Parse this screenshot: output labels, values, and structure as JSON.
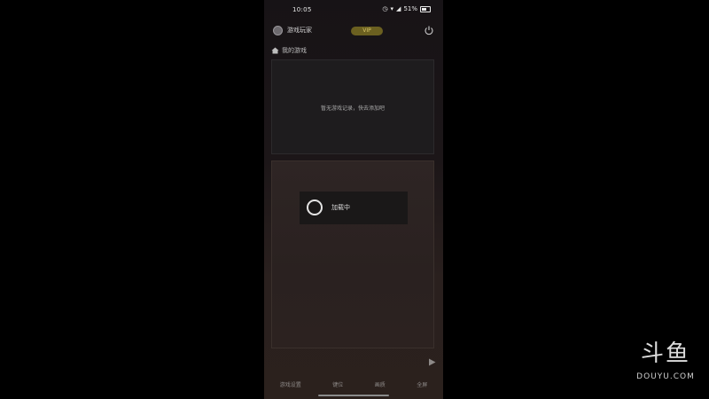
{
  "status_bar": {
    "time": "10:05",
    "icons": [
      "clock-icon",
      "wifi-icon",
      "signal-icon",
      "battery-icon"
    ],
    "battery": "51%"
  },
  "header": {
    "account_name": "游戏玩家",
    "vip_label": "VIP",
    "extra_text": ""
  },
  "section": {
    "title": "我的游戏"
  },
  "panel_top": {
    "message": "暂无游戏记录，快去添加吧"
  },
  "loading": {
    "text": "加载中"
  },
  "bottom_bar": {
    "items": [
      "游戏设置",
      "键位",
      "画质",
      "全屏"
    ]
  },
  "watermark": {
    "logo": "斗鱼",
    "text": "DOUYU.COM"
  },
  "colors": {
    "accent": "#d9c76a",
    "background": "#000000",
    "panel": "#1e1c1e"
  }
}
